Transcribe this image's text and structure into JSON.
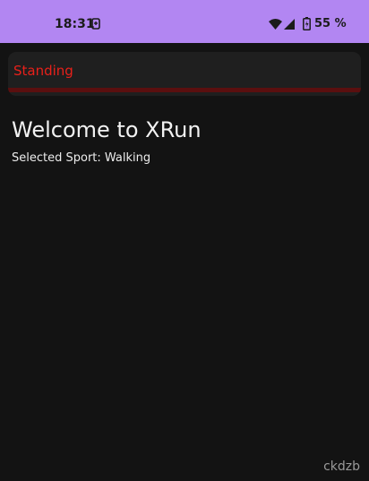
{
  "status_bar": {
    "time": "18:31",
    "battery_percent": "55 %",
    "icons": [
      "notification-icon",
      "wifi-icon",
      "signal-icon",
      "battery-icon"
    ],
    "background_color": "#b286f2"
  },
  "activity_status": {
    "label": "Standing",
    "label_color": "#e8201a",
    "progress": 0
  },
  "main": {
    "title": "Welcome to XRun",
    "sport_prefix": "Selected Sport: ",
    "sport_value": "Walking"
  },
  "watermark": "ckdzb"
}
